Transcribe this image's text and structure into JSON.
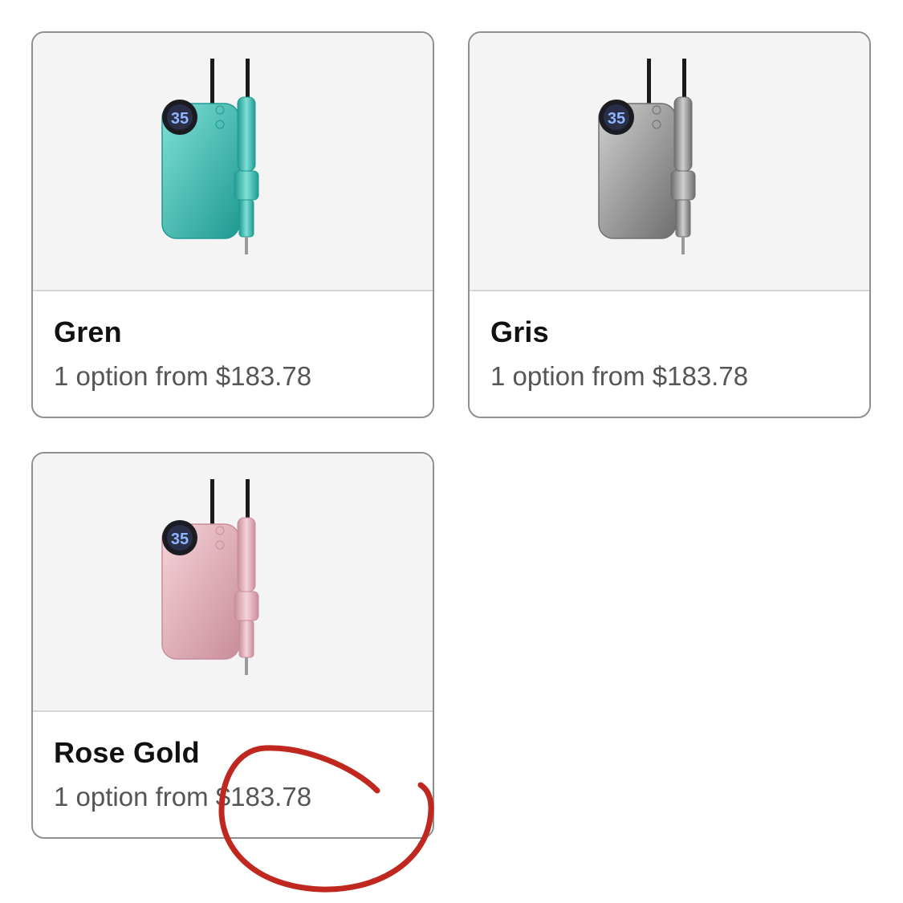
{
  "variants": [
    {
      "name": "Gren",
      "subtitle": "1 option from $183.78",
      "image_icon": "nail-drill-green-icon",
      "color": "#3fc7bd",
      "color_dark": "#1f9a92",
      "color_light": "#7fe0d6"
    },
    {
      "name": "Gris",
      "subtitle": "1 option from $183.78",
      "image_icon": "nail-drill-grey-icon",
      "color": "#9a9a9a",
      "color_dark": "#6e6e6e",
      "color_light": "#cfcfcf"
    },
    {
      "name": "Rose Gold",
      "subtitle": "1 option from $183.78",
      "image_icon": "nail-drill-rose-gold-icon",
      "color": "#e9b3be",
      "color_dark": "#c98d9a",
      "color_light": "#f6d3da"
    }
  ],
  "annotation": {
    "type": "hand-drawn-circle",
    "color": "#c0281f"
  },
  "device_display_value": "35"
}
